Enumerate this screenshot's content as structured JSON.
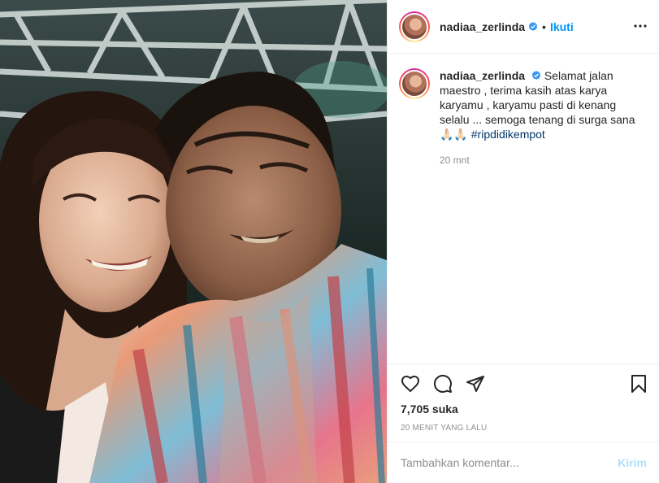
{
  "post": {
    "image_alt": "selfie photo",
    "author": {
      "username": "nadiaa_zerlinda",
      "verified": true,
      "avatar_icon": "profile-avatar"
    },
    "header": {
      "separator": "•",
      "follow_label": "Ikuti",
      "more_icon": "more-options-icon"
    },
    "caption": {
      "username": "nadiaa_zerlinda",
      "text": "Selamat jalan maestro , terima kasih atas karya karyamu , karyamu pasti di kenang selalu ... semoga tenang di surga sana 🙏🏻🙏🏻 ",
      "hashtag": "#ripdidikempot",
      "time": "20 mnt"
    },
    "actions": {
      "icons": [
        "heart-icon",
        "comment-icon",
        "share-icon",
        "bookmark-icon"
      ],
      "likes": "7,705 suka",
      "posted_ago": "20 MENIT YANG LALU"
    },
    "comment": {
      "placeholder": "Tambahkan komentar...",
      "post_label": "Kirim"
    },
    "colors": {
      "link_blue": "#0095f6",
      "post_disabled": "#b2dffc",
      "hashtag": "#00376b",
      "muted": "#8e8e8e",
      "verified_blue": "#3897f0"
    }
  }
}
